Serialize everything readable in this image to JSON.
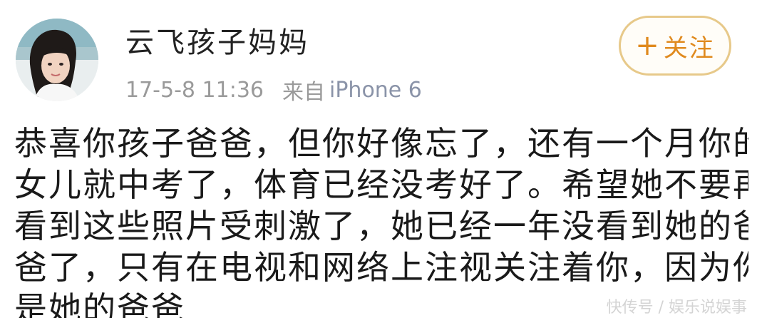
{
  "author": {
    "name": "云飞孩子妈妈",
    "avatar_icon": "profile-photo"
  },
  "meta": {
    "time": "17-5-8 11:36",
    "from_label": "来自",
    "device": "iPhone 6"
  },
  "follow": {
    "plus": "+",
    "label": "关注",
    "color": "#e08a1e",
    "border_color": "#e7c98a"
  },
  "post": {
    "lines": [
      "恭喜你孩子爸爸，但你好像忘了，还有一个月你的",
      "女儿就中考了，体育已经没考好了。希望她不要再",
      "看到这些照片受刺激了，她已经一年没看到她的爸",
      "爸了，只有在电视和网络上注视关注着你，因为你",
      "是她的爸爸"
    ]
  },
  "watermark": {
    "text": "快传号 / 娱乐说娱事"
  }
}
